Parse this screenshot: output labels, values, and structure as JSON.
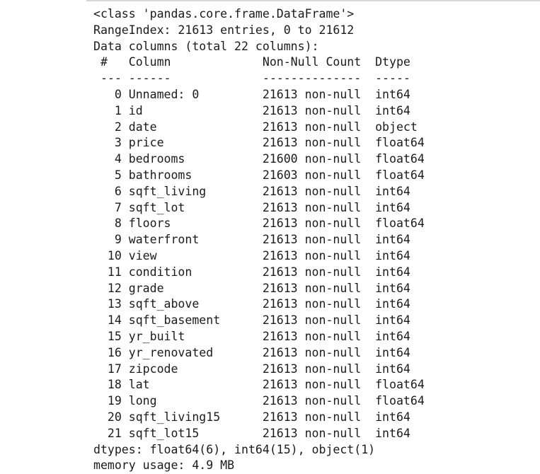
{
  "output": {
    "class_line": "<class 'pandas.core.frame.DataFrame'>",
    "range_index_line": "RangeIndex: 21613 entries, 0 to 21612",
    "data_columns_line": "Data columns (total 22 columns):",
    "header": {
      "index_label": "#",
      "column_label": "Column",
      "non_null_label": "Non-Null Count",
      "dtype_label": "Dtype"
    },
    "separator": {
      "index_rule": "---",
      "column_rule": "------",
      "non_null_rule": "--------------",
      "dtype_rule": "-----"
    },
    "non_null_suffix": "non-null",
    "rows": [
      {
        "index": "0",
        "column": "Unnamed: 0",
        "count": "21613",
        "nonnull": "non-null",
        "dtype": "int64"
      },
      {
        "index": "1",
        "column": "id",
        "count": "21613",
        "nonnull": "non-null",
        "dtype": "int64"
      },
      {
        "index": "2",
        "column": "date",
        "count": "21613",
        "nonnull": "non-null",
        "dtype": "object"
      },
      {
        "index": "3",
        "column": "price",
        "count": "21613",
        "nonnull": "non-null",
        "dtype": "float64"
      },
      {
        "index": "4",
        "column": "bedrooms",
        "count": "21600",
        "nonnull": "non-null",
        "dtype": "float64"
      },
      {
        "index": "5",
        "column": "bathrooms",
        "count": "21603",
        "nonnull": "non-null",
        "dtype": "float64"
      },
      {
        "index": "6",
        "column": "sqft_living",
        "count": "21613",
        "nonnull": "non-null",
        "dtype": "int64"
      },
      {
        "index": "7",
        "column": "sqft_lot",
        "count": "21613",
        "nonnull": "non-null",
        "dtype": "int64"
      },
      {
        "index": "8",
        "column": "floors",
        "count": "21613",
        "nonnull": "non-null",
        "dtype": "float64"
      },
      {
        "index": "9",
        "column": "waterfront",
        "count": "21613",
        "nonnull": "non-null",
        "dtype": "int64"
      },
      {
        "index": "10",
        "column": "view",
        "count": "21613",
        "nonnull": "non-null",
        "dtype": "int64"
      },
      {
        "index": "11",
        "column": "condition",
        "count": "21613",
        "nonnull": "non-null",
        "dtype": "int64"
      },
      {
        "index": "12",
        "column": "grade",
        "count": "21613",
        "nonnull": "non-null",
        "dtype": "int64"
      },
      {
        "index": "13",
        "column": "sqft_above",
        "count": "21613",
        "nonnull": "non-null",
        "dtype": "int64"
      },
      {
        "index": "14",
        "column": "sqft_basement",
        "count": "21613",
        "nonnull": "non-null",
        "dtype": "int64"
      },
      {
        "index": "15",
        "column": "yr_built",
        "count": "21613",
        "nonnull": "non-null",
        "dtype": "int64"
      },
      {
        "index": "16",
        "column": "yr_renovated",
        "count": "21613",
        "nonnull": "non-null",
        "dtype": "int64"
      },
      {
        "index": "17",
        "column": "zipcode",
        "count": "21613",
        "nonnull": "non-null",
        "dtype": "int64"
      },
      {
        "index": "18",
        "column": "lat",
        "count": "21613",
        "nonnull": "non-null",
        "dtype": "float64"
      },
      {
        "index": "19",
        "column": "long",
        "count": "21613",
        "nonnull": "non-null",
        "dtype": "float64"
      },
      {
        "index": "20",
        "column": "sqft_living15",
        "count": "21613",
        "nonnull": "non-null",
        "dtype": "int64"
      },
      {
        "index": "21",
        "column": "sqft_lot15",
        "count": "21613",
        "nonnull": "non-null",
        "dtype": "int64"
      }
    ],
    "dtypes_line": "dtypes: float64(6), int64(15), object(1)",
    "memory_usage_line": "memory usage: 4.9 MB"
  },
  "colors": {
    "background": "#ffffff",
    "text": "#1b1b1b",
    "top_border": "#d6d6d6"
  }
}
